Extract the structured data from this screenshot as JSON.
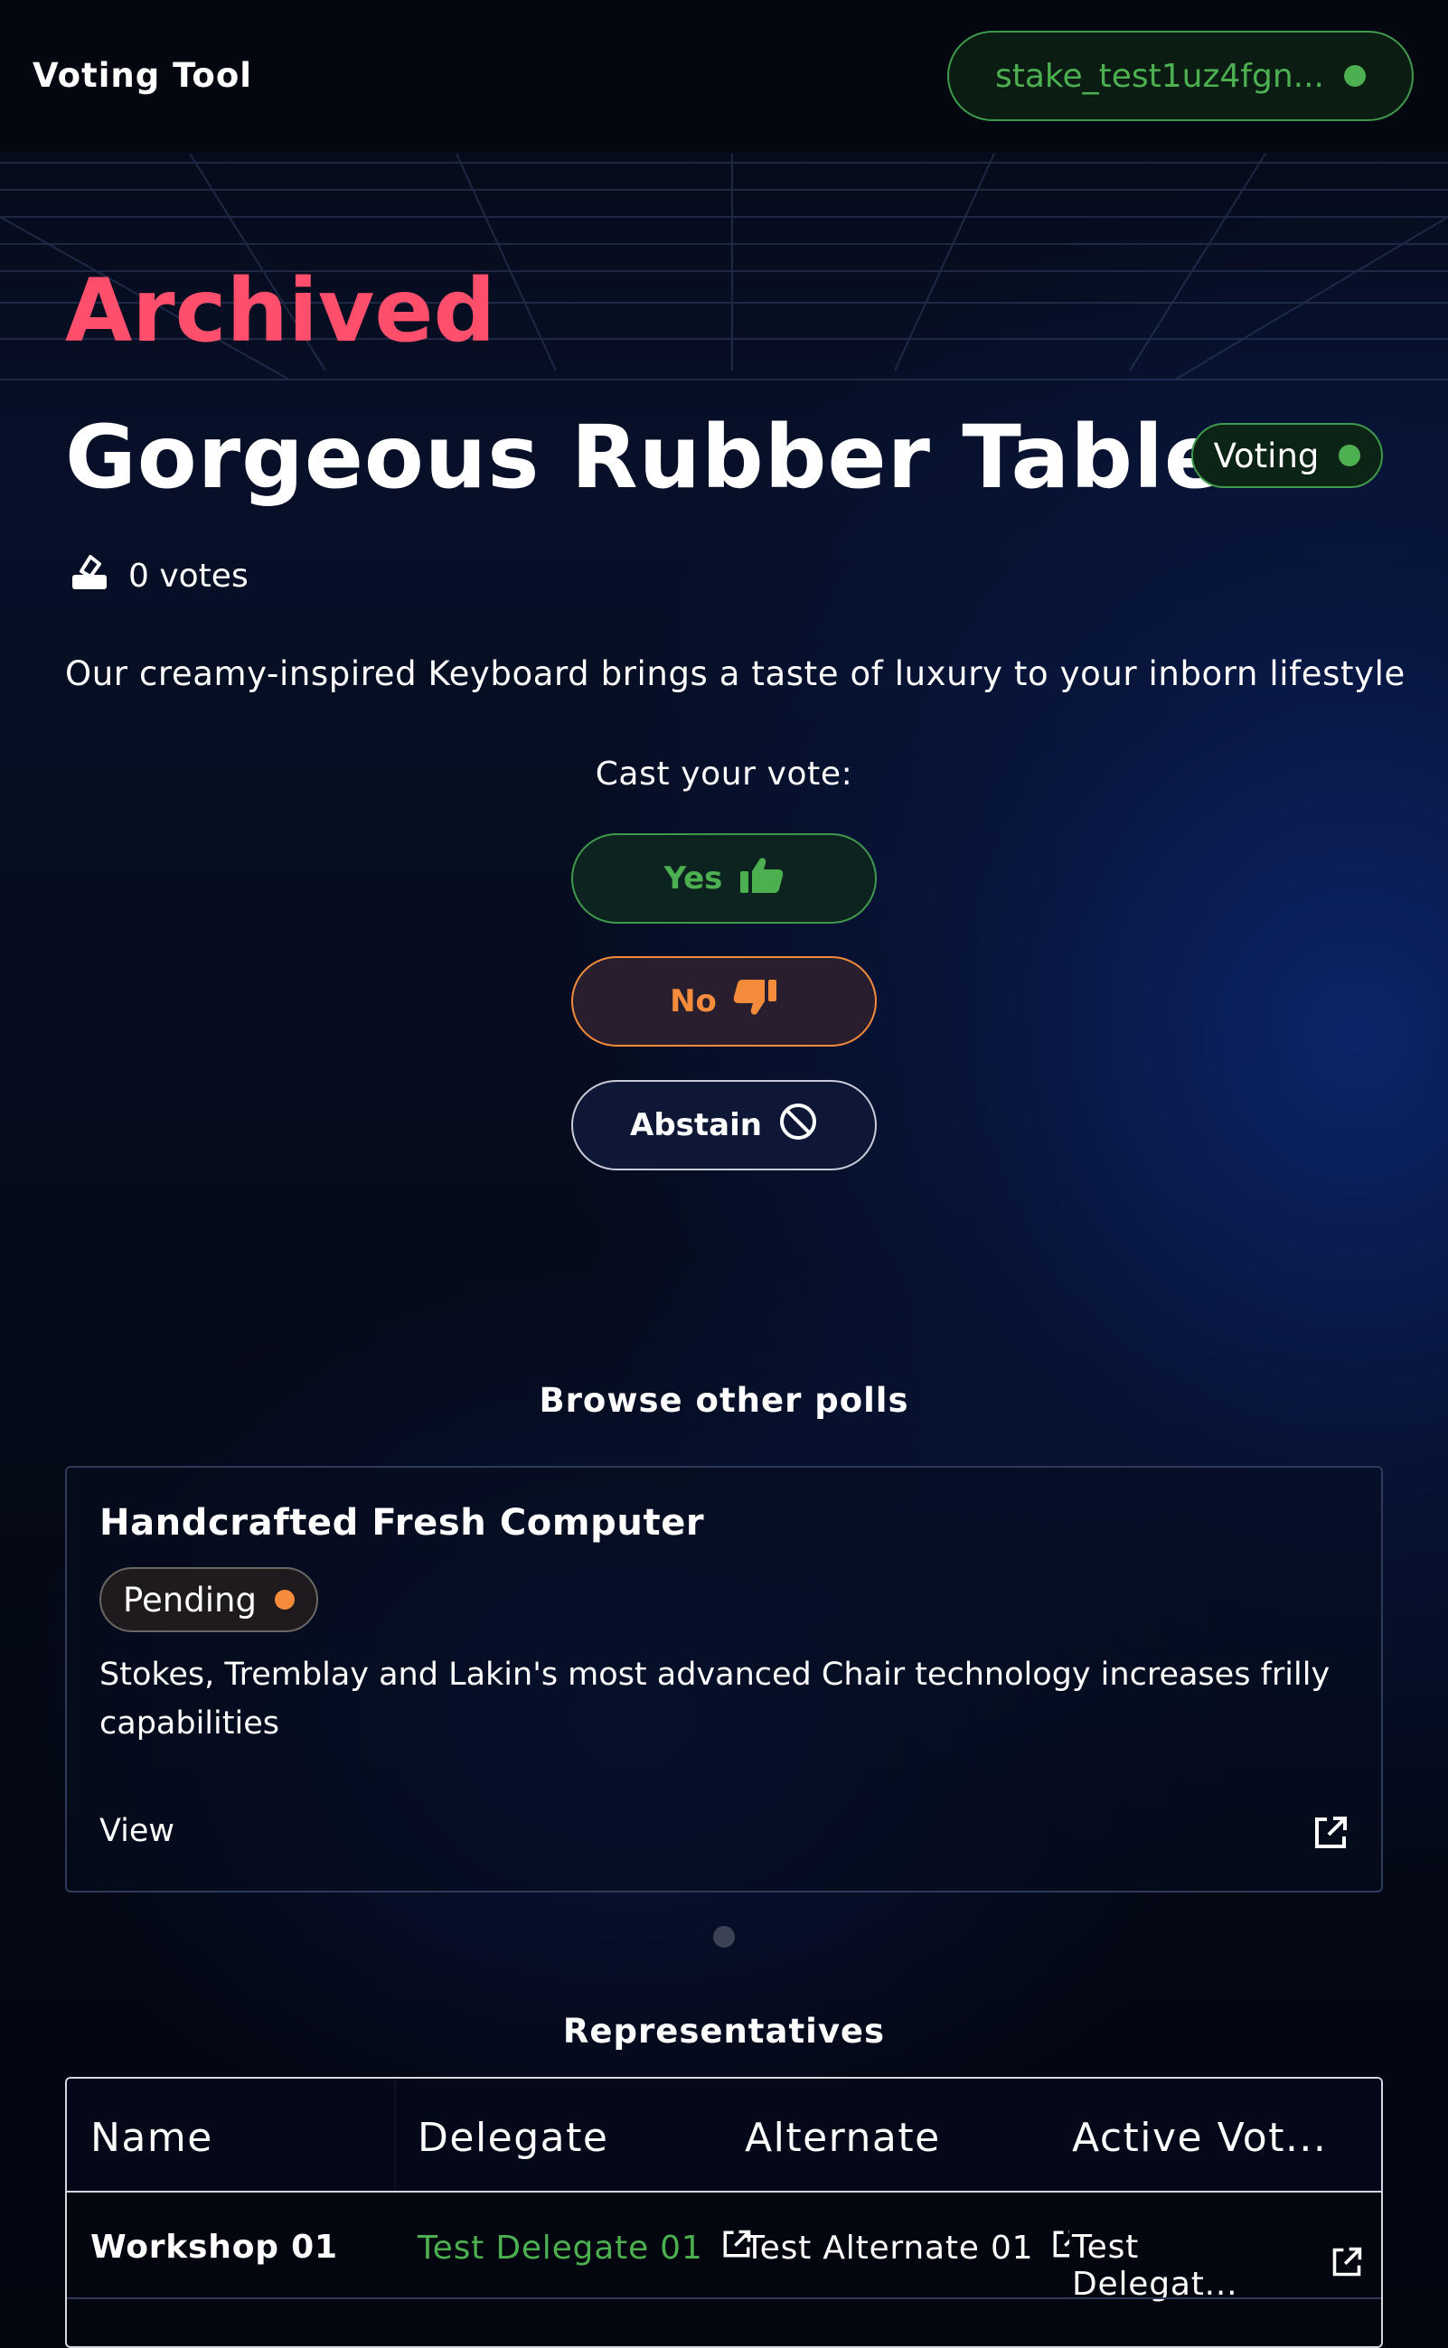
{
  "header": {
    "brand": "Voting Tool",
    "wallet_address": "stake_test1uz4fgn..."
  },
  "poll": {
    "archived_label": "Archived",
    "title": "Gorgeous Rubber Table",
    "status": "Voting",
    "votes_label": "0 votes",
    "description": "Our creamy-inspired Keyboard brings a taste of luxury to your inborn lifestyle",
    "cast_prompt": "Cast your vote:",
    "buttons": {
      "yes": "Yes",
      "no": "No",
      "abstain": "Abstain"
    }
  },
  "browse": {
    "title": "Browse other polls",
    "cards": [
      {
        "title": "Handcrafted Fresh Computer",
        "status": "Pending",
        "description": "Stokes, Tremblay and Lakin's most advanced Chair technology increases frilly capabilities",
        "view_label": "View"
      }
    ]
  },
  "representatives": {
    "title": "Representatives",
    "columns": [
      "Name",
      "Delegate",
      "Alternate",
      "Active Vot..."
    ],
    "rows": [
      {
        "name": "Workshop 01",
        "delegate": "Test Delegate 01",
        "alternate": "Test Alternate 01",
        "active_voter": "Test Delegat..."
      }
    ]
  },
  "colors": {
    "accent_green": "#4caf50",
    "archived_red": "#ff4f6d",
    "pending_orange": "#f48c3c",
    "background": "#03060f"
  },
  "icons": {
    "votes": "ballot-box-icon",
    "yes": "thumbs-up-icon",
    "no": "thumbs-down-icon",
    "abstain": "prohibited-icon",
    "view": "external-link-icon"
  }
}
